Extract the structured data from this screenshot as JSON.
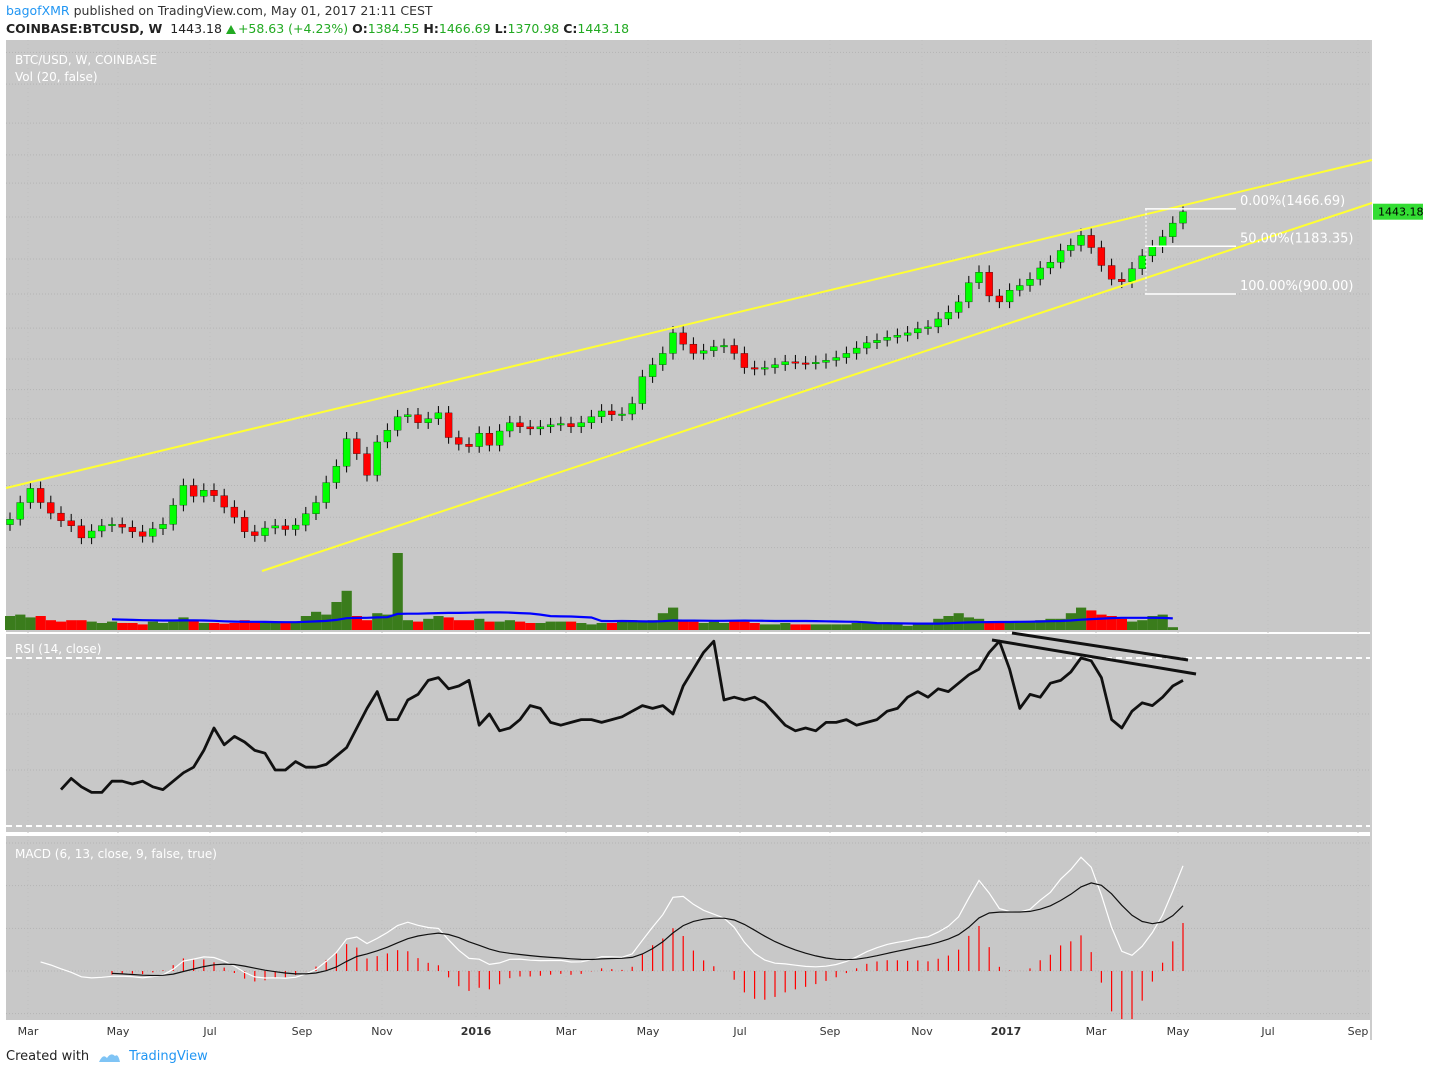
{
  "header": {
    "publisher": "bagofXMR",
    "published_text": "published on TradingView.com, May 01, 2017 21:11 CEST",
    "symbol": "COINBASE:BTCUSD, W",
    "last": "1443.18",
    "change": "+58.63 (+4.23%)",
    "o_label": "O:",
    "o_value": "1384.55",
    "h_label": "H:",
    "h_value": "1466.69",
    "l_label": "L:",
    "l_value": "1370.98",
    "c_label": "C:",
    "c_value": "1443.18"
  },
  "footer": {
    "created_with": "Created with",
    "brand": "TradingView"
  },
  "colors": {
    "up": "#00ff00",
    "down": "#ff0000",
    "vol_up": "#3a7c1c",
    "vol_down": "#ff0000",
    "pane_bg": "#c8c8c8",
    "channel": "#ffff33",
    "vol_ma": "#0000ff",
    "price_badge": "#33dd33"
  },
  "chart_data": [
    {
      "type": "candlestick",
      "title": "BTC/USD, W, COINBASE",
      "scale": "log",
      "y_ticks": [
        "3600.00",
        "3000.00",
        "2400.00",
        "2000.00",
        "1700.00",
        "1400.00",
        "1100.00",
        "900.00",
        "740.00",
        "620.00",
        "520.00",
        "440.00",
        "360.00",
        "300.00",
        "250.00",
        "210.00"
      ],
      "x_labels": [
        "Mar",
        "May",
        "Jul",
        "Sep",
        "Nov",
        "2016",
        "Mar",
        "May",
        "Jul",
        "Sep",
        "Nov",
        "2017",
        "Mar",
        "May",
        "Jul",
        "Sep"
      ],
      "last_price": "1443.18",
      "close_start": 247,
      "closes": [
        247,
        272,
        295,
        272,
        256,
        245,
        238,
        222,
        231,
        238,
        240,
        236,
        230,
        224,
        234,
        240,
        268,
        300,
        282,
        292,
        283,
        265,
        250,
        230,
        225,
        235,
        238,
        233,
        239,
        255,
        272,
        305,
        335,
        392,
        360,
        318,
        385,
        412,
        445,
        450,
        430,
        440,
        455,
        395,
        380,
        375,
        405,
        378,
        410,
        430,
        420,
        415,
        420,
        425,
        428,
        420,
        430,
        445,
        460,
        450,
        452,
        480,
        560,
        600,
        640,
        720,
        675,
        640,
        650,
        665,
        670,
        640,
        590,
        585,
        590,
        600,
        610,
        606,
        605,
        608,
        615,
        625,
        640,
        660,
        680,
        690,
        702,
        710,
        720,
        738,
        745,
        780,
        810,
        860,
        960,
        1020,
        890,
        860,
        920,
        945,
        980,
        1045,
        1080,
        1155,
        1190,
        1260,
        1175,
        1060,
        980,
        965,
        1040,
        1120,
        1180,
        1250,
        1352,
        1443
      ],
      "fib_levels": [
        {
          "label": "0.00%(1466.69)",
          "price": 1466.69
        },
        {
          "label": "50.00%(1183.35)",
          "price": 1183.35
        },
        {
          "label": "100.00%(900.00)",
          "price": 900.0
        }
      ]
    },
    {
      "type": "bar",
      "title": "Vol (20, false)",
      "y_ticks": [
        "178.00",
        "150.50"
      ],
      "values": [
        1.0,
        1.1,
        0.9,
        1.0,
        0.7,
        0.6,
        0.7,
        0.7,
        0.6,
        0.5,
        0.6,
        0.5,
        0.5,
        0.4,
        0.6,
        0.5,
        0.6,
        0.9,
        0.7,
        0.5,
        0.5,
        0.45,
        0.5,
        0.7,
        0.6,
        0.5,
        0.5,
        0.5,
        0.6,
        1.0,
        1.3,
        1.1,
        2.0,
        2.8,
        1.0,
        0.7,
        1.2,
        1.1,
        5.5,
        0.7,
        0.6,
        0.8,
        1.0,
        0.9,
        0.7,
        0.7,
        0.8,
        0.6,
        0.6,
        0.7,
        0.6,
        0.5,
        0.5,
        0.6,
        0.6,
        0.6,
        0.5,
        0.4,
        0.5,
        0.5,
        0.7,
        0.7,
        0.6,
        0.7,
        1.2,
        1.6,
        0.7,
        0.6,
        0.5,
        0.6,
        0.5,
        0.7,
        0.6,
        0.5,
        0.4,
        0.4,
        0.5,
        0.4,
        0.4,
        0.4,
        0.4,
        0.4,
        0.4,
        0.5,
        0.5,
        0.5,
        0.5,
        0.4,
        0.3,
        0.4,
        0.5,
        0.8,
        1.0,
        1.2,
        0.9,
        0.8,
        0.6,
        0.5,
        0.5,
        0.6,
        0.6,
        0.7,
        0.8,
        0.8,
        1.2,
        1.6,
        1.4,
        1.1,
        1.0,
        0.8,
        0.6,
        0.7,
        1.0,
        1.1,
        0.2
      ]
    },
    {
      "type": "line",
      "title": "RSI (14, close)",
      "y_ticks": [
        "80.0000",
        "60.0000",
        "40.0000",
        "20.0000"
      ],
      "ylim": [
        15,
        90
      ],
      "start_index": 5,
      "values": [
        33,
        37,
        34,
        32,
        32,
        36,
        36,
        35,
        36,
        34,
        33,
        36,
        39,
        41,
        47,
        55,
        49,
        52,
        50,
        47,
        46,
        40,
        40,
        43,
        41,
        41,
        42,
        45,
        48,
        55,
        62,
        68,
        58,
        58,
        65,
        67,
        72,
        73,
        69,
        70,
        72,
        56,
        60,
        54,
        55,
        58,
        63,
        62,
        57,
        56,
        57,
        58,
        58,
        57,
        58,
        59,
        61,
        63,
        62,
        63,
        60,
        70,
        76,
        82,
        86,
        65,
        66,
        65,
        66,
        64,
        60,
        56,
        54,
        55,
        54,
        57,
        57,
        58,
        56,
        57,
        58,
        61,
        62,
        66,
        68,
        66,
        69,
        68,
        71,
        74,
        76,
        82,
        86,
        76,
        62,
        67,
        66,
        71,
        72,
        75,
        80,
        79,
        73,
        58,
        55,
        61,
        64,
        63,
        66,
        70,
        72
      ]
    },
    {
      "type": "line",
      "title": "MACD (6, 13, close, 9, false, true)",
      "y_ticks": [
        "120.0000",
        "80.0000",
        "40.0000",
        "0.0000",
        "-40.0000"
      ],
      "ylim": [
        -45,
        125
      ]
    }
  ]
}
